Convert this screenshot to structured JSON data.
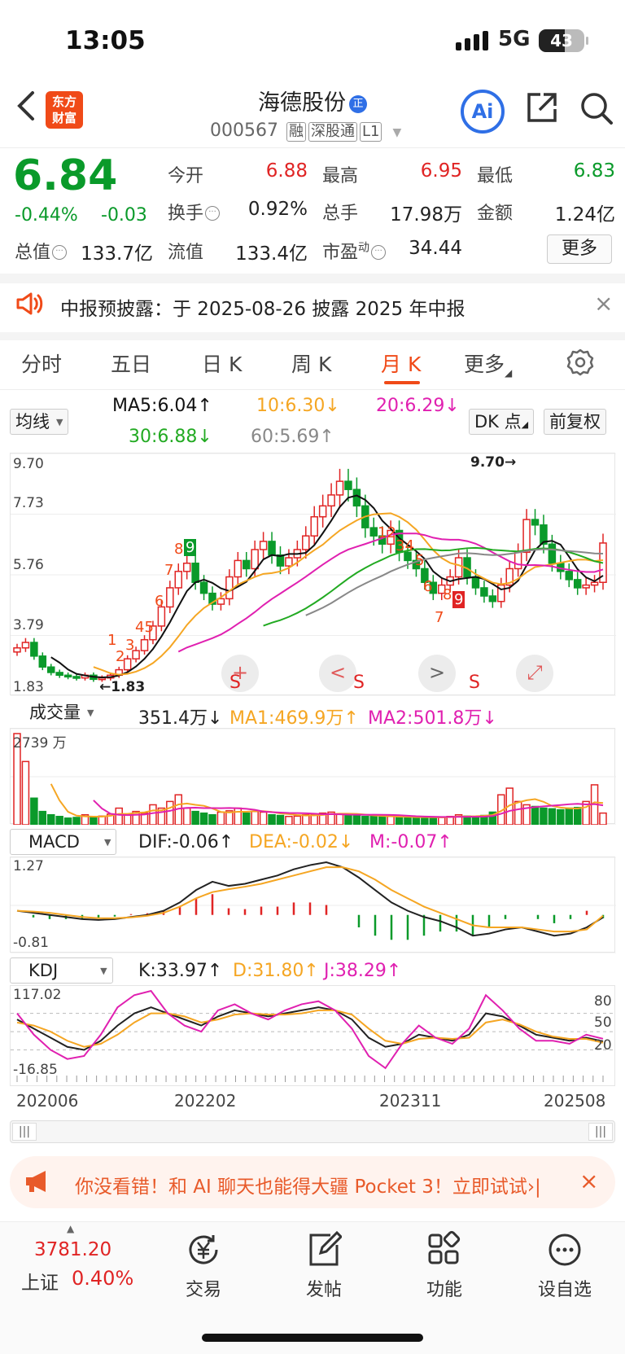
{
  "status": {
    "time": "13:05",
    "network": "5G",
    "battery": "43"
  },
  "header": {
    "logo": "东方财富",
    "stock_name": "海德股份",
    "name_badge": "正",
    "code": "000567",
    "tags": [
      "融",
      "深股通",
      "L1"
    ],
    "ai_label": "Ai"
  },
  "quote": {
    "price": "6.84",
    "change_pct": "-0.44%",
    "change": "-0.03",
    "fields": [
      {
        "k": "今开",
        "v": "6.88",
        "color": "red"
      },
      {
        "k": "最高",
        "v": "6.95",
        "color": "red"
      },
      {
        "k": "最低",
        "v": "6.83",
        "color": "green"
      },
      {
        "k": "换手",
        "v": "0.92%",
        "color": "black"
      },
      {
        "k": "总手",
        "v": "17.98万",
        "color": "black"
      },
      {
        "k": "金额",
        "v": "1.24亿",
        "color": "black"
      },
      {
        "k": "总值",
        "v": "133.7亿",
        "color": "black"
      },
      {
        "k": "流值",
        "v": "133.4亿",
        "color": "black"
      },
      {
        "k": "市盈",
        "v": "34.44",
        "color": "black"
      }
    ],
    "pe_sup": "动",
    "more": "更多"
  },
  "notice": {
    "text": "中报预披露：于 2025-08-26 披露 2025 年中报"
  },
  "tabs": [
    "分时",
    "五日",
    "日 K",
    "周 K",
    "月 K",
    "更多"
  ],
  "active_tab": 4,
  "ma_bar": {
    "selector": "均线",
    "ma5": "MA5:6.04",
    "ma10": "10:6.30",
    "ma20": "20:6.29",
    "ma30": "30:6.88",
    "ma60": "60:5.69",
    "dk": "DK 点",
    "fq": "前复权"
  },
  "kline": {
    "y_labels": [
      "9.70",
      "7.73",
      "5.76",
      "3.79",
      "1.83"
    ],
    "high_label": "9.70",
    "low_label": "1.83",
    "seq_labels": [
      "1",
      "2",
      "3",
      "45",
      "6",
      "7",
      "8",
      "9",
      "12",
      "34",
      "5",
      "6",
      "7",
      "8",
      "9"
    ],
    "s_labels": [
      "S",
      "S",
      "S"
    ],
    "nav": [
      "+",
      "<",
      ">",
      "⤢"
    ]
  },
  "volume": {
    "selector": "成交量",
    "value": "351.4万",
    "ma1": "MA1:469.9万",
    "ma2": "MA2:501.8万",
    "top": "2739 万"
  },
  "macd": {
    "selector": "MACD",
    "dif": "DIF:-0.06",
    "dea": "DEA:-0.02",
    "m": "M:-0.07",
    "top": "1.27",
    "bottom": "-0.81"
  },
  "kdj": {
    "selector": "KDJ",
    "k": "K:33.97",
    "d": "D:31.80",
    "j": "J:38.29",
    "top": "117.02",
    "bottom": "-16.85",
    "levels": [
      "80",
      "50",
      "20"
    ]
  },
  "dates": [
    "202006",
    "202202",
    "202311",
    "202508"
  ],
  "promo": {
    "text": "你没看错！和 AI 聊天也能得大疆 Pocket 3！立即试试"
  },
  "bottom": {
    "index_value": "3781.20",
    "index_name": "上证",
    "index_pct": "0.40%",
    "items": [
      "交易",
      "发帖",
      "功能",
      "设自选"
    ]
  },
  "colors": {
    "up": "#e02424",
    "down": "#0a9a2a",
    "accent": "#f04a18",
    "ma5": "#111111",
    "ma10": "#f5a623",
    "ma20": "#e020b0",
    "ma30": "#22aa22",
    "ma60": "#888888"
  },
  "chart_data": [
    {
      "type": "candlestick",
      "title": "",
      "series_name": "月K",
      "x_range": [
        "202006",
        "202508"
      ],
      "ylim": [
        1.83,
        9.7
      ],
      "close": [
        3.0,
        3.2,
        2.7,
        2.3,
        2.1,
        2.0,
        1.95,
        1.9,
        2.0,
        1.85,
        1.9,
        2.0,
        2.2,
        2.6,
        2.9,
        3.3,
        3.8,
        4.5,
        5.2,
        5.8,
        6.1,
        5.4,
        5.0,
        4.6,
        4.8,
        5.6,
        6.2,
        5.9,
        6.6,
        6.9,
        6.4,
        6.0,
        6.3,
        6.6,
        7.1,
        7.8,
        8.2,
        8.6,
        9.1,
        8.8,
        8.2,
        7.4,
        7.1,
        6.8,
        7.3,
        6.5,
        6.2,
        5.9,
        5.4,
        5.0,
        5.3,
        5.6,
        6.3,
        5.6,
        5.2,
        4.9,
        4.7,
        5.3,
        5.9,
        6.5,
        7.7,
        7.5,
        6.8,
        6.1,
        5.8,
        5.5,
        5.2,
        5.3,
        5.4,
        6.84
      ]
    },
    {
      "type": "bar",
      "title": "成交量",
      "unit": "万",
      "ylim": [
        0,
        2739
      ],
      "values": [
        2739,
        1900,
        800,
        400,
        300,
        250,
        200,
        220,
        300,
        250,
        260,
        320,
        500,
        300,
        400,
        350,
        600,
        500,
        700,
        900,
        500,
        400,
        350,
        300,
        380,
        420,
        500,
        350,
        400,
        380,
        300,
        280,
        250,
        260,
        300,
        320,
        350,
        380,
        320,
        300,
        280,
        250,
        260,
        240,
        250,
        230,
        220,
        210,
        240,
        230,
        220,
        250,
        300,
        260,
        250,
        280,
        380,
        900,
        1100,
        700,
        600,
        550,
        500,
        480,
        450,
        500,
        520,
        700,
        1200,
        351.4
      ]
    },
    {
      "type": "line",
      "title": "MACD",
      "ylim": [
        -0.81,
        1.27
      ],
      "series": [
        {
          "name": "DIF",
          "values": [
            0.1,
            0.05,
            0.0,
            -0.05,
            -0.1,
            -0.12,
            -0.1,
            -0.05,
            0.0,
            0.1,
            0.3,
            0.6,
            0.8,
            0.7,
            0.75,
            0.85,
            0.95,
            1.1,
            1.2,
            1.27,
            1.15,
            0.9,
            0.6,
            0.3,
            0.1,
            -0.05,
            -0.15,
            -0.3,
            -0.5,
            -0.45,
            -0.35,
            -0.3,
            -0.4,
            -0.5,
            -0.45,
            -0.3,
            -0.06
          ]
        },
        {
          "name": "DEA",
          "values": [
            0.1,
            0.08,
            0.05,
            0.0,
            -0.05,
            -0.08,
            -0.08,
            -0.06,
            -0.02,
            0.05,
            0.2,
            0.4,
            0.55,
            0.62,
            0.68,
            0.75,
            0.85,
            0.95,
            1.05,
            1.15,
            1.15,
            1.05,
            0.85,
            0.6,
            0.4,
            0.2,
            0.05,
            -0.1,
            -0.25,
            -0.3,
            -0.3,
            -0.3,
            -0.35,
            -0.4,
            -0.4,
            -0.35,
            -0.02
          ]
        }
      ]
    },
    {
      "type": "line",
      "title": "KDJ",
      "ylim": [
        -16.85,
        117.02
      ],
      "series": [
        {
          "name": "K",
          "values": [
            70,
            55,
            40,
            25,
            20,
            35,
            60,
            80,
            90,
            80,
            70,
            60,
            75,
            85,
            80,
            75,
            80,
            85,
            90,
            85,
            70,
            40,
            25,
            30,
            45,
            40,
            35,
            45,
            80,
            75,
            60,
            45,
            40,
            35,
            40,
            33.97
          ]
        },
        {
          "name": "D",
          "values": [
            65,
            60,
            50,
            35,
            25,
            30,
            45,
            65,
            80,
            80,
            75,
            65,
            70,
            78,
            80,
            78,
            78,
            80,
            85,
            85,
            78,
            55,
            35,
            30,
            38,
            40,
            38,
            40,
            65,
            70,
            62,
            50,
            42,
            38,
            38,
            31.8
          ]
        },
        {
          "name": "J",
          "values": [
            80,
            45,
            20,
            5,
            10,
            45,
            90,
            110,
            117,
            80,
            60,
            50,
            85,
            95,
            80,
            70,
            85,
            95,
            100,
            85,
            55,
            10,
            -10,
            30,
            60,
            40,
            30,
            55,
            110,
            85,
            55,
            35,
            35,
            30,
            45,
            38.29
          ]
        }
      ]
    }
  ]
}
